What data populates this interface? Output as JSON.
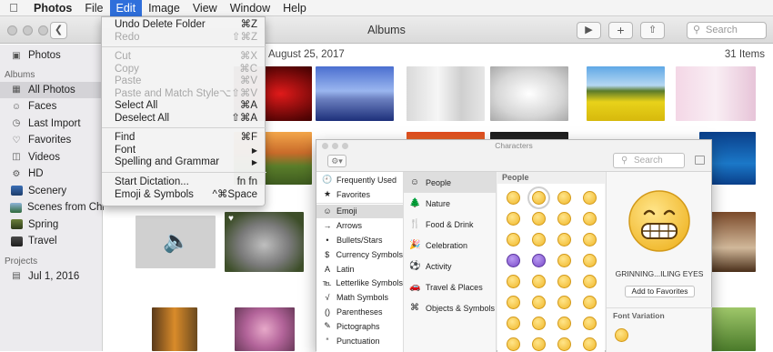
{
  "menubar": {
    "app": "Photos",
    "items": [
      "File",
      "Edit",
      "Image",
      "View",
      "Window",
      "Help"
    ]
  },
  "window": {
    "title": "Albums",
    "search_placeholder": "Search"
  },
  "sidebar": {
    "top_item": "Photos",
    "albums_header": "Albums",
    "albums": [
      "All Photos",
      "Faces",
      "Last Import",
      "Favorites",
      "Videos",
      "HD",
      "Scenery",
      "Scenes from China",
      "Spring",
      "Travel"
    ],
    "projects_header": "Projects",
    "projects": [
      "Jul 1, 2016"
    ]
  },
  "content": {
    "date": "August 25, 2017",
    "count": "31 Items"
  },
  "edit_menu": {
    "undo": {
      "label": "Undo Delete Folder",
      "shortcut": "⌘Z"
    },
    "redo": {
      "label": "Redo",
      "shortcut": "⇧⌘Z"
    },
    "cut": {
      "label": "Cut",
      "shortcut": "⌘X"
    },
    "copy": {
      "label": "Copy",
      "shortcut": "⌘C"
    },
    "paste": {
      "label": "Paste",
      "shortcut": "⌘V"
    },
    "paste_match": {
      "label": "Paste and Match Style",
      "shortcut": "⌥⇧⌘V"
    },
    "select_all": {
      "label": "Select All",
      "shortcut": "⌘A"
    },
    "deselect_all": {
      "label": "Deselect All",
      "shortcut": "⇧⌘A"
    },
    "find": {
      "label": "Find",
      "shortcut": "⌘F"
    },
    "font": {
      "label": "Font",
      "shortcut": "▶"
    },
    "spelling": {
      "label": "Spelling and Grammar",
      "shortcut": "▶"
    },
    "dictation": {
      "label": "Start Dictation...",
      "shortcut": "fn fn"
    },
    "emoji": {
      "label": "Emoji & Symbols",
      "shortcut": "^⌘Space"
    }
  },
  "characters": {
    "title": "Characters",
    "search_placeholder": "Search",
    "categories": [
      "Frequently Used",
      "Favorites",
      "Emoji",
      "Arrows",
      "Bullets/Stars",
      "Currency Symbols",
      "Latin",
      "Letterlike Symbols",
      "Math Symbols",
      "Parentheses",
      "Pictographs",
      "Punctuation"
    ],
    "category_icons": [
      "🕘",
      "★",
      "☺",
      "→",
      "•",
      "$",
      "A",
      "℡",
      "√",
      "()",
      "✎",
      "“"
    ],
    "subcategories": [
      "People",
      "Nature",
      "Food & Drink",
      "Celebration",
      "Activity",
      "Travel & Places",
      "Objects & Symbols"
    ],
    "subcategory_icons": [
      "☺",
      "🌲",
      "🍴",
      "🎉",
      "⚽",
      "🚗",
      "⌘"
    ],
    "grid_header": "People",
    "preview_name": "GRINNING...ILING EYES",
    "add_favorites": "Add to Favorites",
    "font_variation": "Font Variation"
  },
  "colors": {
    "accent": "#2f6fdb",
    "emoji_yellow": "#f0b72a"
  }
}
